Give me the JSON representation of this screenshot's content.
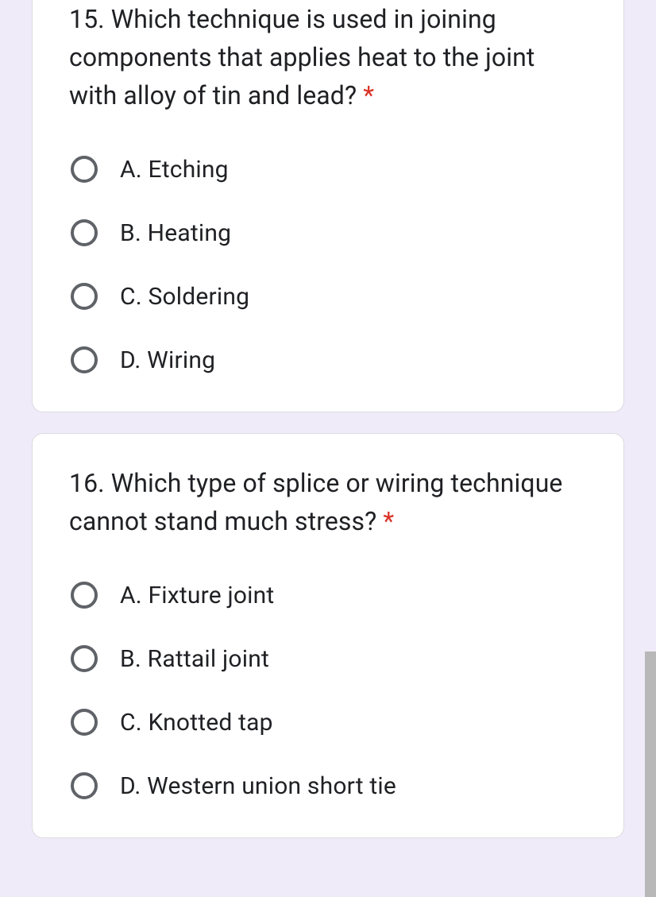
{
  "questions": [
    {
      "number": "15.",
      "text": "Which technique is used in joining components that applies heat to the joint with alloy of tin and lead?",
      "required": "*",
      "options": [
        "A. Etching",
        "B. Heating",
        "C. Soldering",
        "D. Wiring"
      ]
    },
    {
      "number": "16.",
      "text": "Which type of splice or wiring technique cannot stand much stress?",
      "required": "*",
      "options": [
        "A. Fixture joint",
        "B. Rattail joint",
        "C. Knotted tap",
        "D. Western union short tie"
      ]
    }
  ]
}
